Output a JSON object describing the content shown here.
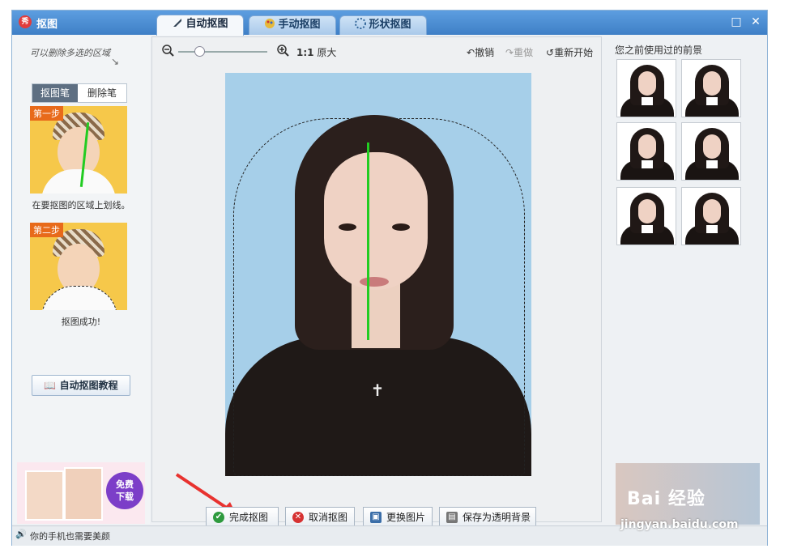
{
  "window": {
    "title": "抠图",
    "app_icon": "秀"
  },
  "tabs": [
    {
      "label": "自动抠图",
      "icon": "brush-icon"
    },
    {
      "label": "手动抠图",
      "icon": "paint-icon"
    },
    {
      "label": "形状抠图",
      "icon": "shape-icon"
    }
  ],
  "left_panel": {
    "hint": "可以删除多选的区域",
    "seg": {
      "active": "抠图笔",
      "inactive": "删除笔"
    },
    "step1_badge": "第一步",
    "step1_caption": "在要抠图的区域上划线。",
    "step2_badge": "第二步",
    "step2_caption": "抠图成功!",
    "tutorial_button": "自动抠图教程",
    "promo_badge_line1": "免费",
    "promo_badge_line2": "下载"
  },
  "toolbar": {
    "zoom_ratio": "1:1",
    "original_size": "原大",
    "undo": "撤销",
    "redo": "重做",
    "restart": "重新开始"
  },
  "bottom_buttons": {
    "done": "完成抠图",
    "cancel": "取消抠图",
    "replace": "更换图片",
    "save_transparent": "保存为透明背景"
  },
  "right_panel": {
    "title": "您之前使用过的前景"
  },
  "status": {
    "text": "你的手机也需要美颜"
  },
  "watermark": {
    "text": "Bai 经验",
    "url": "jingyan.baidu.com"
  },
  "colors": {
    "accent": "#3f7fc6",
    "green_stroke": "#22cc22",
    "arrow": "#e8322f"
  }
}
